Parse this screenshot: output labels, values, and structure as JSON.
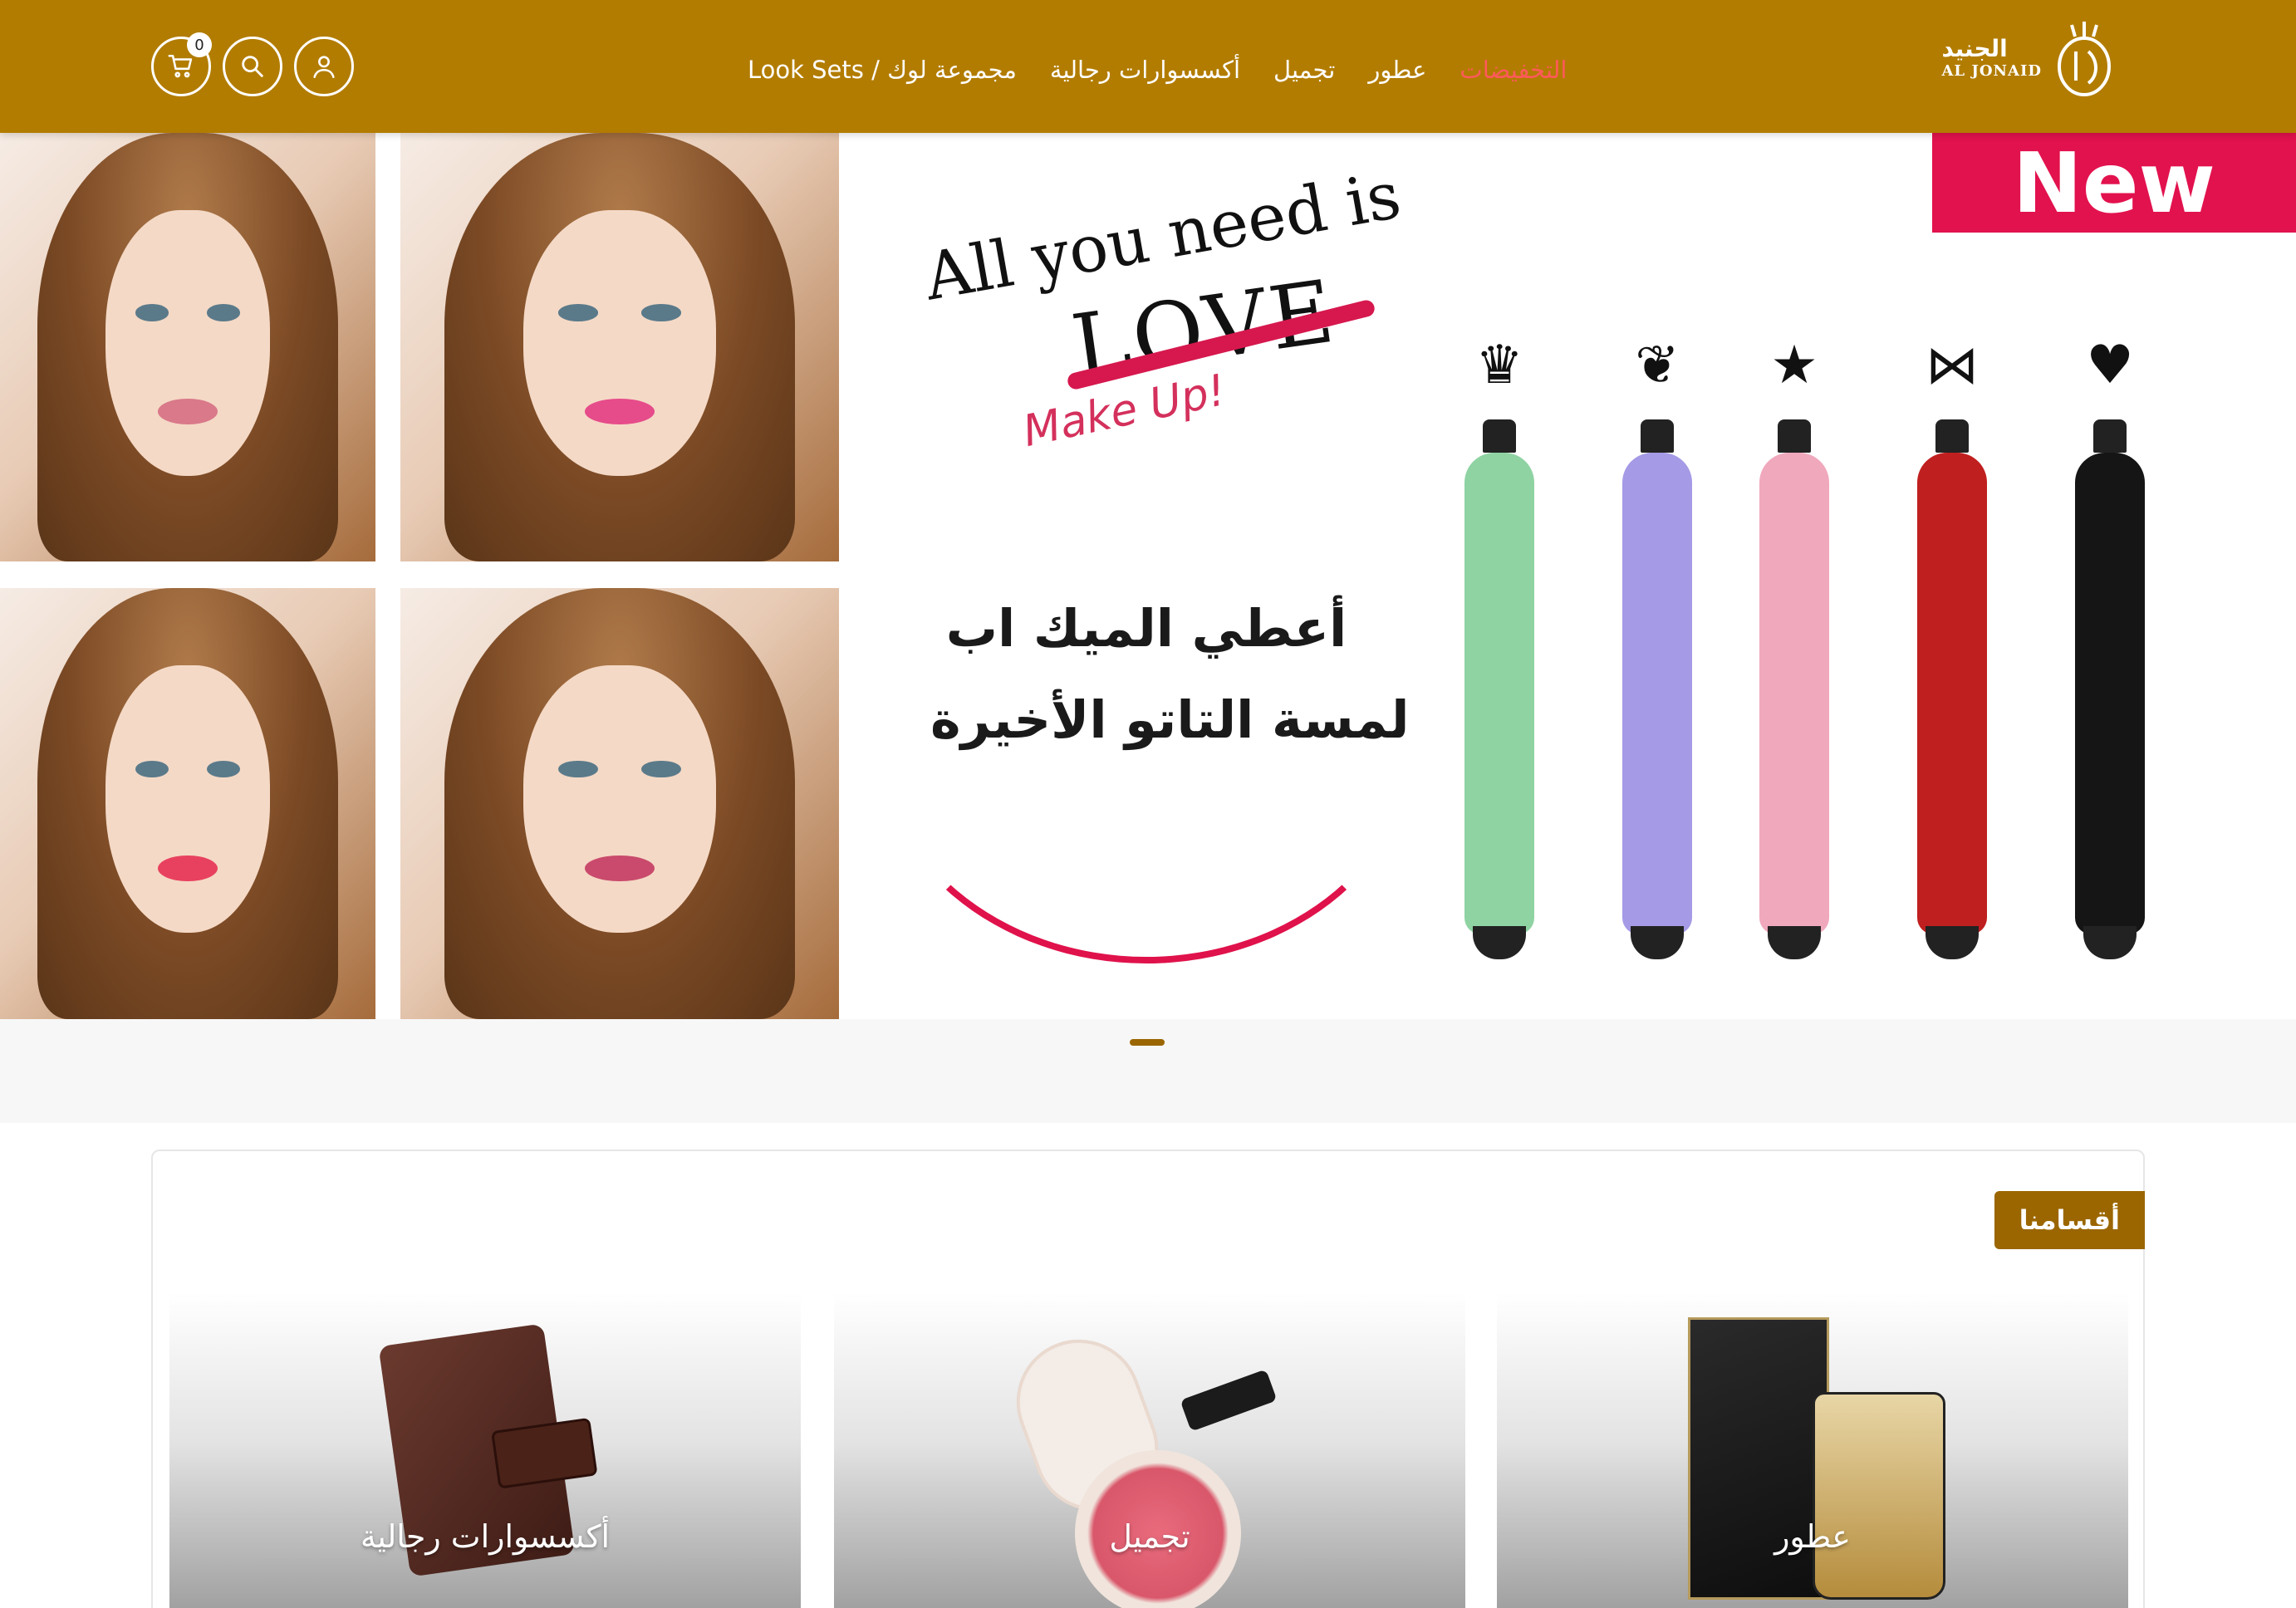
{
  "header": {
    "cart_count": "0",
    "nav": [
      {
        "label": "Look Sets / مجموعة لوك"
      },
      {
        "label": "أكسسوارات رجالية"
      },
      {
        "label": "تجميل"
      },
      {
        "label": "عطور"
      },
      {
        "label": "التخفيضات",
        "active": true
      }
    ],
    "logo": {
      "arabic": "الجنيد",
      "english": "AL JONAID"
    }
  },
  "hero": {
    "headline": "All you need is",
    "crossed_word": "LOVE",
    "script": "Make Up!",
    "arabic_line_1": "أعطي الميك اب",
    "arabic_line_2": "لمسة التاتو الأخيرة",
    "badge": "New",
    "pens": [
      {
        "color": "#8fd3a3",
        "shape": "crown-icon",
        "glyph": "♛"
      },
      {
        "color": "#a49ae6",
        "shape": "butterfly-icon",
        "glyph": "❦"
      },
      {
        "color": "#f0a8bd",
        "shape": "star-icon",
        "glyph": "★"
      },
      {
        "color": "#c01f1f",
        "shape": "bow-icon",
        "glyph": "⋈"
      },
      {
        "color": "#151515",
        "shape": "heart-icon",
        "glyph": "♥"
      }
    ],
    "slides_total": 1,
    "active_slide": 1
  },
  "categories": {
    "title": "أقسامنا",
    "items": [
      {
        "label": "أكسسوارات رجالية"
      },
      {
        "label": "تجميل"
      },
      {
        "label": "عطور"
      }
    ]
  },
  "colors": {
    "brand": "#b27c00",
    "brand_dark": "#9b6600",
    "accent": "#e2124e",
    "nav_active": "#ff5a5a"
  }
}
